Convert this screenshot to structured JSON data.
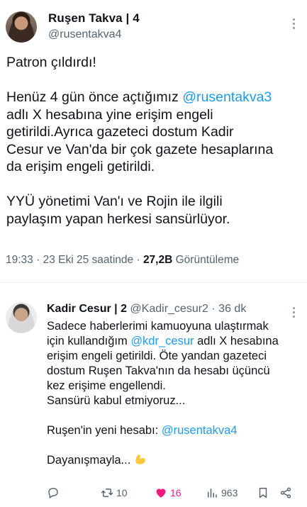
{
  "tweet": {
    "author_name": "Ruşen Takva | 4",
    "author_handle": "@rusentakva4",
    "lines": [
      {
        "parts": [
          {
            "t": "Patron çıldırdı!"
          }
        ]
      },
      {
        "gap": true
      },
      {
        "parts": [
          {
            "t": "Henüz 4 gün önce açtığımız "
          },
          {
            "t": "@rusentakva3",
            "link": true
          }
        ]
      },
      {
        "parts": [
          {
            "t": "adlı X hesabına yine erişim engeli"
          }
        ]
      },
      {
        "parts": [
          {
            "t": "getirildi.Ayrıca gazeteci dostum Kadir"
          }
        ]
      },
      {
        "parts": [
          {
            "t": "Cesur ve Van'da bir çok gazete hesaplarına"
          }
        ]
      },
      {
        "parts": [
          {
            "t": "da erişim engeli getirildi."
          }
        ]
      },
      {
        "gap": true
      },
      {
        "parts": [
          {
            "t": "YYÜ yönetimi Van'ı ve Rojin ile ilgili"
          }
        ]
      },
      {
        "parts": [
          {
            "t": "paylaşım yapan herkesi sansürlüyor."
          }
        ]
      }
    ],
    "time": "19:33",
    "date": "23 Eki 25 saatinde",
    "views_count": "27,2B",
    "views_label": "Görüntüleme",
    "separator": "·"
  },
  "reply": {
    "author_name": "Kadir Cesur | 2",
    "author_handle": "@Kadir_cesur2",
    "age": "36 dk",
    "separator": "·",
    "lines": [
      {
        "parts": [
          {
            "t": "Sadece haberlerimi kamuoyuna ulaştırmak"
          }
        ]
      },
      {
        "parts": [
          {
            "t": "için kullandığım "
          },
          {
            "t": "@kdr_cesur",
            "link": true
          },
          {
            "t": " adlı X hesabına"
          }
        ]
      },
      {
        "parts": [
          {
            "t": "erişim engeli getirildi. Öte yandan gazeteci"
          }
        ]
      },
      {
        "parts": [
          {
            "t": "dostum Ruşen Takva'nın da hesabı üçüncü"
          }
        ]
      },
      {
        "parts": [
          {
            "t": "kez erişime engellendi."
          }
        ]
      },
      {
        "parts": [
          {
            "t": "Sansürü kabul etmiyoruz..."
          }
        ]
      },
      {
        "gap": true
      },
      {
        "parts": [
          {
            "t": "Ruşen'in yeni hesabı: "
          },
          {
            "t": "@rusentakva4",
            "link": true
          }
        ]
      },
      {
        "gap": true
      },
      {
        "parts": [
          {
            "t": "Dayanışmayla... "
          },
          {
            "emoji": "flexed-biceps"
          }
        ]
      }
    ],
    "actions": {
      "reply_count": "",
      "retweet_count": "10",
      "like_count": "16",
      "views_count": "963"
    }
  },
  "colors": {
    "link": "#1d9bf0",
    "text": "#0f1419",
    "muted": "#536471",
    "like": "#f91880",
    "emoji": "#ffc83d"
  }
}
